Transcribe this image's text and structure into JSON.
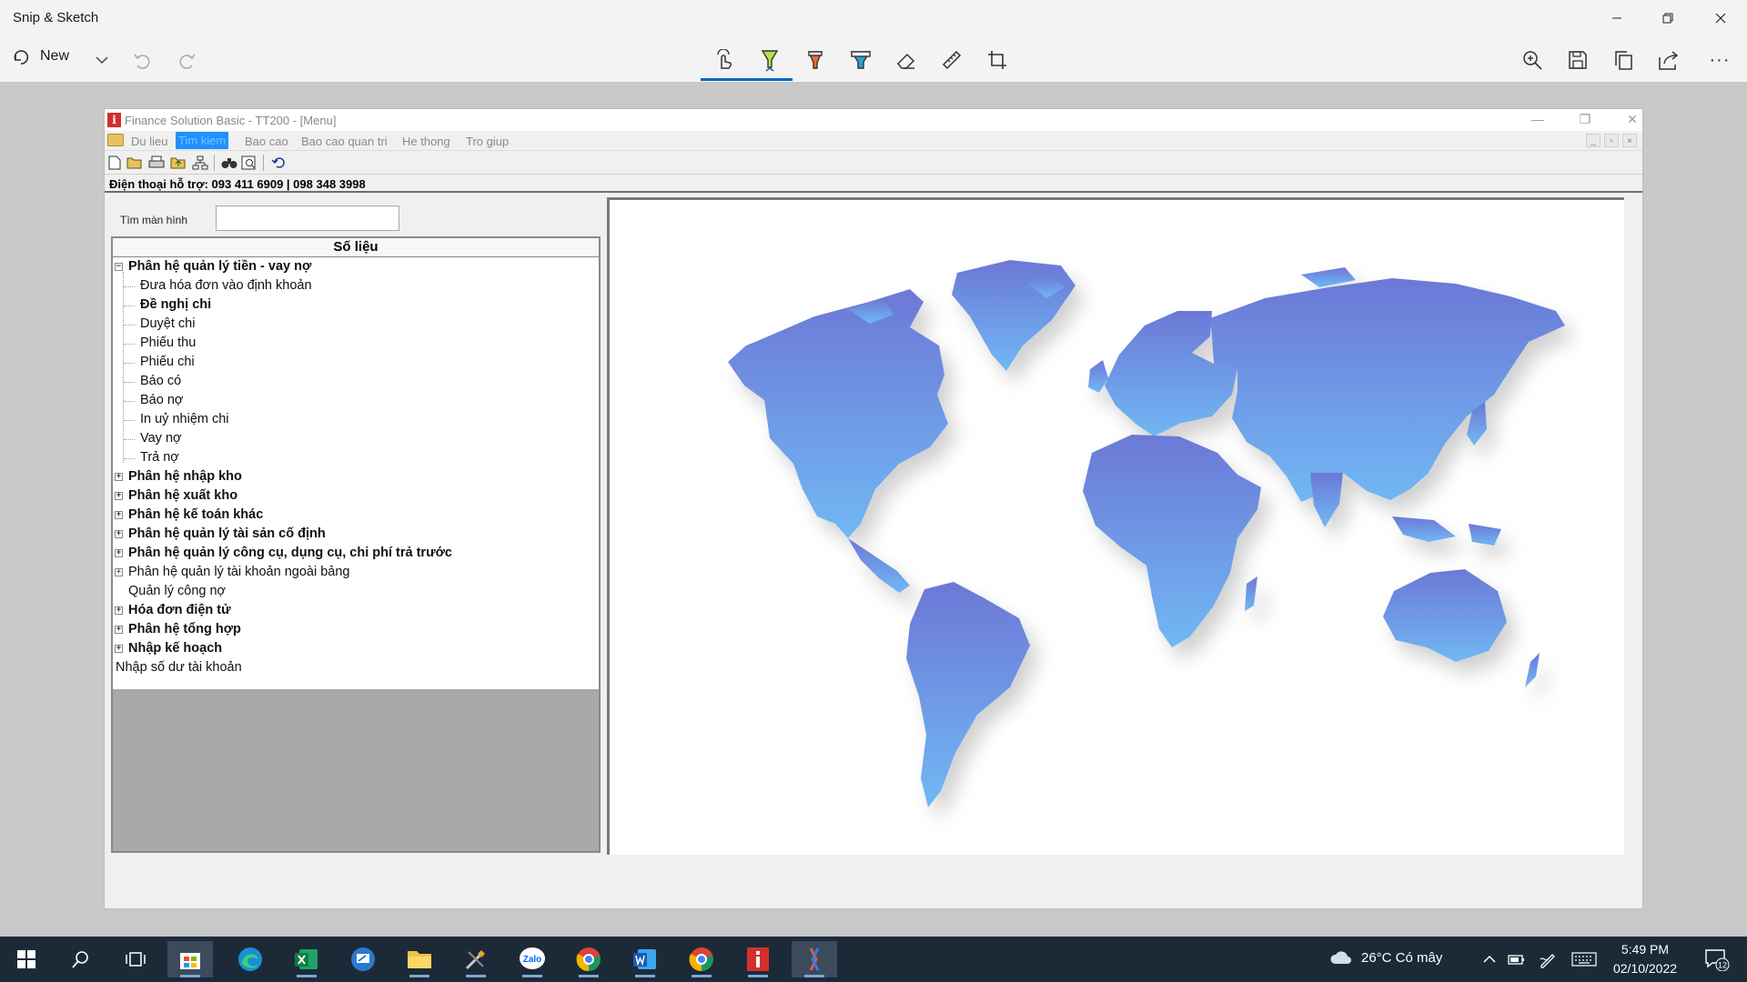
{
  "outer_app": {
    "title": "Snip & Sketch",
    "new_label": "New",
    "window_buttons": [
      "minimize",
      "restore",
      "close"
    ],
    "toolbar_tools": [
      "touch-writing-icon",
      "ballpoint-pen-icon",
      "pencil-icon",
      "highlighter-icon",
      "eraser-icon",
      "ruler-icon",
      "crop-icon"
    ],
    "right_tools": [
      "zoom-icon",
      "save-icon",
      "copy-icon",
      "share-icon",
      "more-icon"
    ],
    "more_label": "···"
  },
  "inner_app": {
    "title": "Finance Solution Basic - TT200 - [Menu]",
    "logo_letter": "i",
    "menu": [
      "Du lieu",
      "Tim kiem",
      "Bao cao",
      "Bao cao quan tri",
      "He thong",
      "Tro giup"
    ],
    "active_menu": "Tim kiem",
    "hotline": "Điện thoại hỗ trợ: 093 411 6909 | 098 348 3998",
    "search_label": "Tìm màn hình",
    "search_value": "",
    "tree_header": "Số liệu",
    "tree": [
      {
        "label": "Phân hệ quản lý tiền -  vay nợ",
        "level": 0,
        "bold": true,
        "expander": "−"
      },
      {
        "label": "Đưa hóa đơn vào định khoản",
        "level": 1,
        "bold": false
      },
      {
        "label": "Đề nghị chi",
        "level": 1,
        "bold": true
      },
      {
        "label": "Duyệt chi",
        "level": 1,
        "bold": false
      },
      {
        "label": "Phiếu thu",
        "level": 1,
        "bold": false
      },
      {
        "label": "Phiếu chi",
        "level": 1,
        "bold": false
      },
      {
        "label": "Báo có",
        "level": 1,
        "bold": false
      },
      {
        "label": "Báo nợ",
        "level": 1,
        "bold": false
      },
      {
        "label": "In uỷ nhiệm chi",
        "level": 1,
        "bold": false
      },
      {
        "label": "Vay nợ",
        "level": 1,
        "bold": false
      },
      {
        "label": "Trả nợ",
        "level": 1,
        "bold": false
      },
      {
        "label": "Phân hệ nhập kho",
        "level": 0,
        "bold": true,
        "expander": "+"
      },
      {
        "label": "Phân hệ xuất kho",
        "level": 0,
        "bold": true,
        "expander": "+"
      },
      {
        "label": "Phân hệ kế toán khác",
        "level": 0,
        "bold": true,
        "expander": "+"
      },
      {
        "label": "Phân hệ quản lý tài sản cố định",
        "level": 0,
        "bold": true,
        "expander": "+"
      },
      {
        "label": "Phân hệ quản lý công cụ, dụng cụ, chi phí trả trước",
        "level": 0,
        "bold": true,
        "expander": "+"
      },
      {
        "label": "Phân hệ quản lý tài khoản ngoài bảng",
        "level": 0,
        "bold": false,
        "expander": "+"
      },
      {
        "label": "Quản lý công nợ",
        "level": 0,
        "bold": false
      },
      {
        "label": "Hóa đơn điện tử",
        "level": 0,
        "bold": true,
        "expander": "+"
      },
      {
        "label": "Phân hệ  tổng hợp",
        "level": 0,
        "bold": true,
        "expander": "+"
      },
      {
        "label": "Nhập kế hoạch",
        "level": 0,
        "bold": true,
        "expander": "+"
      },
      {
        "label": "Nhập số dư tài khoản",
        "level": -1,
        "bold": false
      }
    ]
  },
  "taskbar": {
    "apps": [
      "start-icon",
      "search-icon",
      "task-view-icon",
      "store-icon",
      "edge-icon",
      "excel-icon",
      "remote-app-icon",
      "file-explorer-icon",
      "tools-icon",
      "zalo-icon",
      "chrome-profile-icon",
      "word-icon",
      "chrome-icon",
      "finance-app-icon",
      "snip-sketch-icon"
    ],
    "zalo_text": "Zalo",
    "weather": "26°C  Có mây",
    "time": "5:49 PM",
    "date": "02/10/2022",
    "notification_count": "12"
  },
  "colors": {
    "accent": "#0067c0",
    "map_top": "#6f7fd8",
    "map_bottom": "#6fb3f2",
    "menu_active": "#1e90ff"
  }
}
